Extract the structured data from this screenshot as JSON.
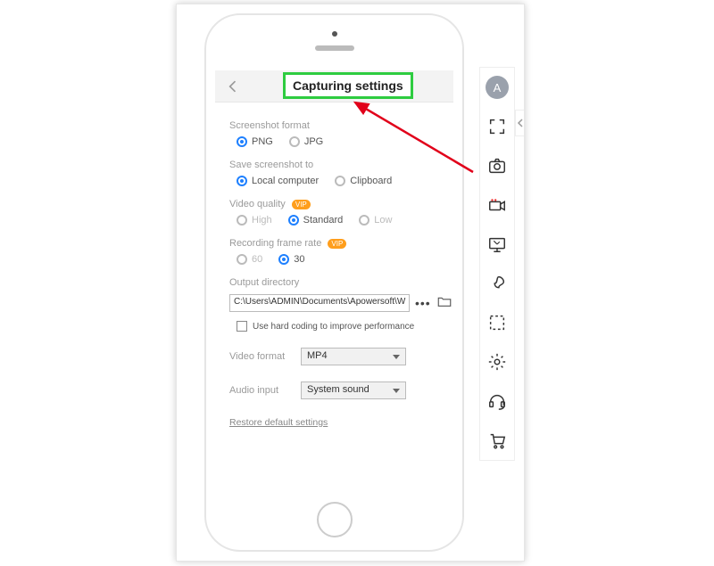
{
  "header": {
    "title": "Capturing settings"
  },
  "screenshot_format": {
    "label": "Screenshot format",
    "options": {
      "png": "PNG",
      "jpg": "JPG"
    }
  },
  "save_to": {
    "label": "Save screenshot to",
    "options": {
      "local": "Local computer",
      "clip": "Clipboard"
    }
  },
  "video_quality": {
    "label": "Video quality",
    "badge": "VIP",
    "options": {
      "high": "High",
      "standard": "Standard",
      "low": "Low"
    }
  },
  "frame_rate": {
    "label": "Recording frame rate",
    "badge": "VIP",
    "options": {
      "sixty": "60",
      "thirty": "30"
    }
  },
  "output_dir": {
    "label": "Output directory",
    "path": "C:\\Users\\ADMIN\\Documents\\Apowersoft\\W",
    "browse": "•••"
  },
  "hardcoding_label": "Use hard coding to improve performance",
  "video_format": {
    "label": "Video format",
    "value": "MP4"
  },
  "audio_input": {
    "label": "Audio input",
    "value": "System sound"
  },
  "restore_label": "Restore default settings",
  "avatar_letter": "A"
}
